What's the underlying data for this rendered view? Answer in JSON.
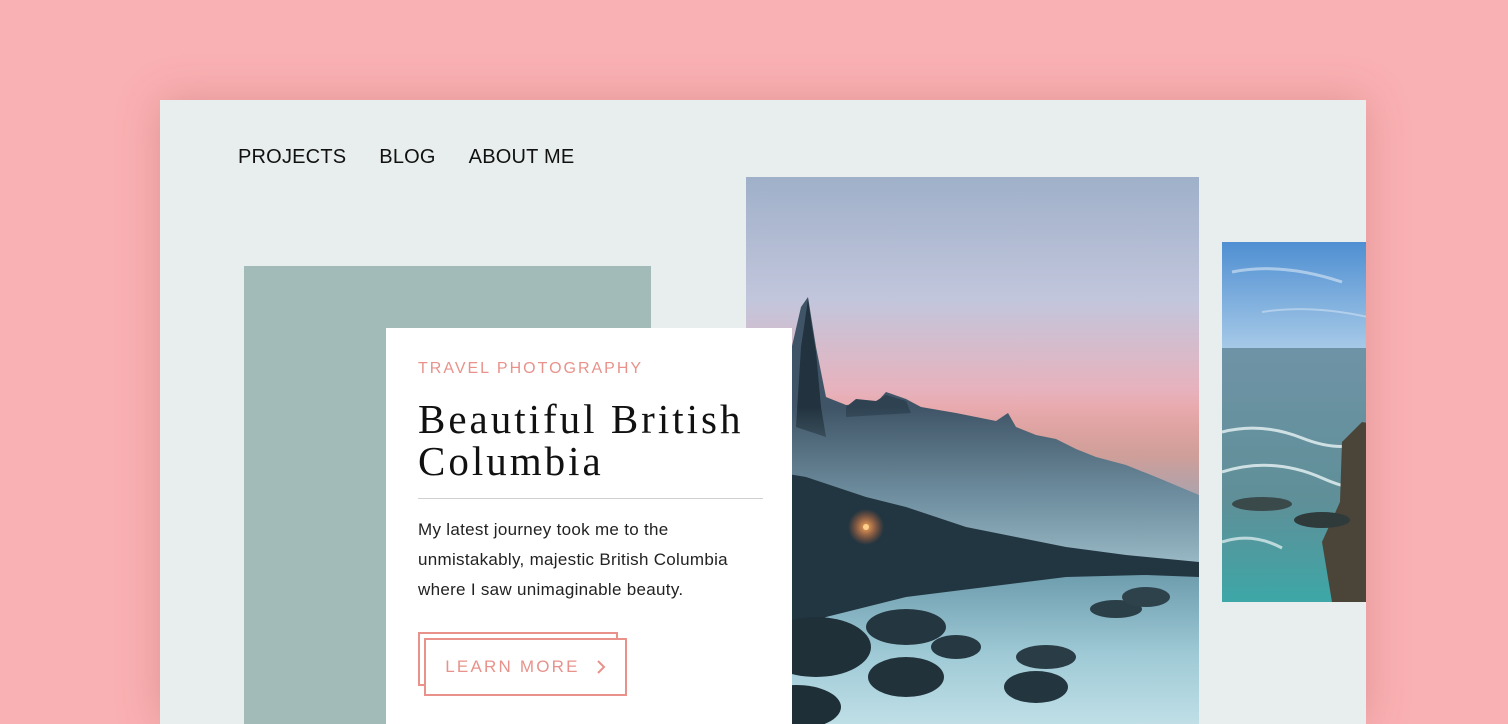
{
  "nav": {
    "items": [
      {
        "label": "PROJECTS"
      },
      {
        "label": "BLOG"
      },
      {
        "label": "ABOUT ME"
      }
    ]
  },
  "card": {
    "eyebrow": "TRAVEL PHOTOGRAPHY",
    "title_line1": "Beautiful British",
    "title_line2": "Columbia",
    "body_line1": "My latest journey took me to the",
    "body_line2": "unmistakably, majestic British Columbia",
    "body_line3": "where I saw unimaginable beauty.",
    "button_label": "LEARN MORE",
    "button_icon": "chevron-right-icon"
  },
  "colors": {
    "page_background": "#fab1b3",
    "panel_background": "#e8eeed",
    "sage_block": "#a3bbb8",
    "accent": "#e8928b",
    "text": "#111111"
  }
}
